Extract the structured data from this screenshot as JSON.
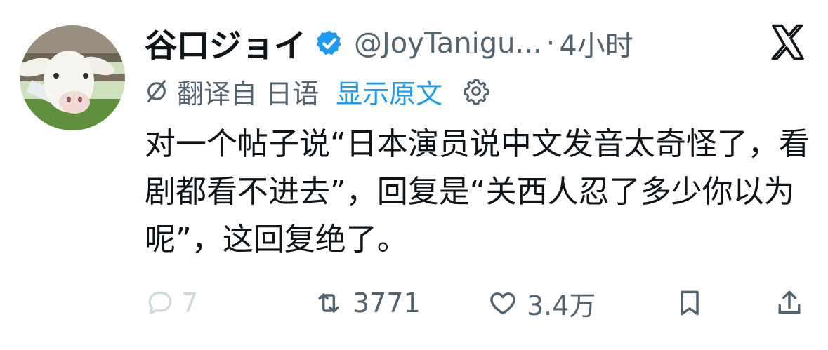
{
  "author": {
    "display_name": "谷口ジョイ",
    "handle": "@JoyTanigu...",
    "separator": "·",
    "time": "4小时"
  },
  "translation": {
    "label": "翻译自 日语",
    "show_original": "显示原文"
  },
  "tweet": {
    "text": "对一个帖子说“日本演员说中文发音太奇怪了，看剧都看不进去”，回复是“关西人忍了多少你以为呢”，这回复绝了。"
  },
  "actions": {
    "reply_count": "7",
    "retweet_count": "3771",
    "like_count": "3.4万"
  },
  "colors": {
    "verified": "#1d9bf0",
    "link": "#1d9bf0",
    "secondary_text": "#536471",
    "disabled": "#cfd9de"
  },
  "icons": [
    "avatar-goat",
    "verified-badge-icon",
    "x-logo-icon",
    "translate-icon",
    "gear-icon",
    "reply-icon",
    "retweet-icon",
    "like-icon",
    "bookmark-icon",
    "share-icon"
  ]
}
